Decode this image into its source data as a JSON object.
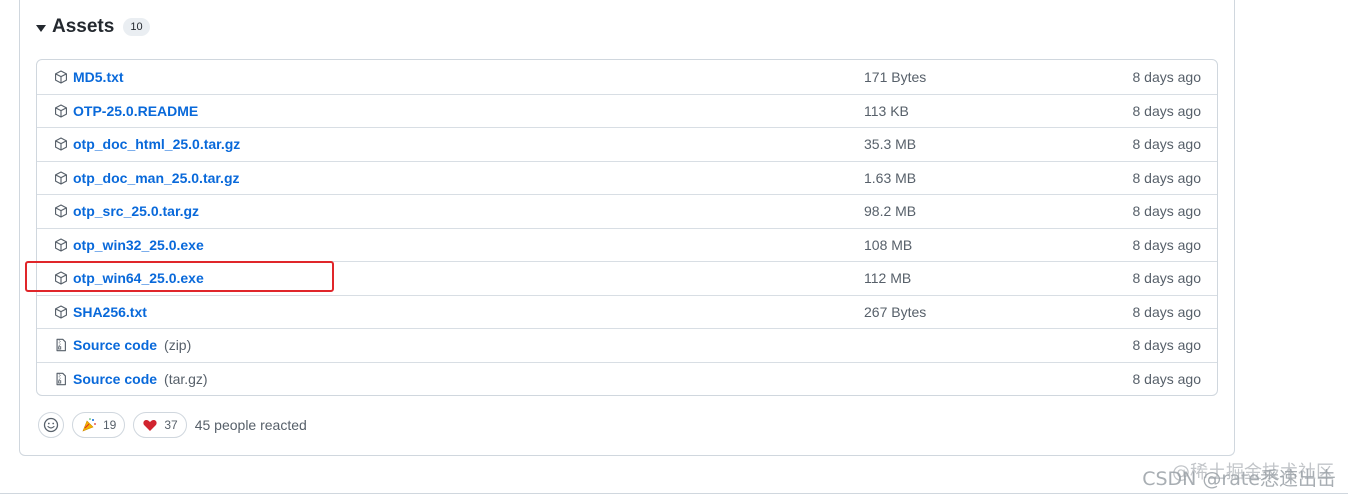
{
  "assets": {
    "title": "Assets",
    "count": "10",
    "items": [
      {
        "name": "MD5.txt",
        "suffix": "",
        "size": "171 Bytes",
        "time": "8 days ago",
        "icon": "package-icon"
      },
      {
        "name": "OTP-25.0.README",
        "suffix": "",
        "size": "113 KB",
        "time": "8 days ago",
        "icon": "package-icon"
      },
      {
        "name": "otp_doc_html_25.0.tar.gz",
        "suffix": "",
        "size": "35.3 MB",
        "time": "8 days ago",
        "icon": "package-icon"
      },
      {
        "name": "otp_doc_man_25.0.tar.gz",
        "suffix": "",
        "size": "1.63 MB",
        "time": "8 days ago",
        "icon": "package-icon"
      },
      {
        "name": "otp_src_25.0.tar.gz",
        "suffix": "",
        "size": "98.2 MB",
        "time": "8 days ago",
        "icon": "package-icon"
      },
      {
        "name": "otp_win32_25.0.exe",
        "suffix": "",
        "size": "108 MB",
        "time": "8 days ago",
        "icon": "package-icon"
      },
      {
        "name": "otp_win64_25.0.exe",
        "suffix": "",
        "size": "112 MB",
        "time": "8 days ago",
        "icon": "package-icon"
      },
      {
        "name": "SHA256.txt",
        "suffix": "",
        "size": "267 Bytes",
        "time": "8 days ago",
        "icon": "package-icon"
      },
      {
        "name": "Source code",
        "suffix": "(zip)",
        "size": "",
        "time": "8 days ago",
        "icon": "file-zip-icon"
      },
      {
        "name": "Source code",
        "suffix": "(tar.gz)",
        "size": "",
        "time": "8 days ago",
        "icon": "file-zip-icon"
      }
    ]
  },
  "reactions": {
    "hooray_count": "19",
    "heart_count": "37",
    "summary": "45 people reacted"
  },
  "watermark": "CSDN @rate悉速出击",
  "watermark_top": "@稀土掘金技术社区",
  "colors": {
    "link": "#0969da",
    "highlight": "#e0262a",
    "muted": "#57606a",
    "border": "#d0d7de"
  }
}
